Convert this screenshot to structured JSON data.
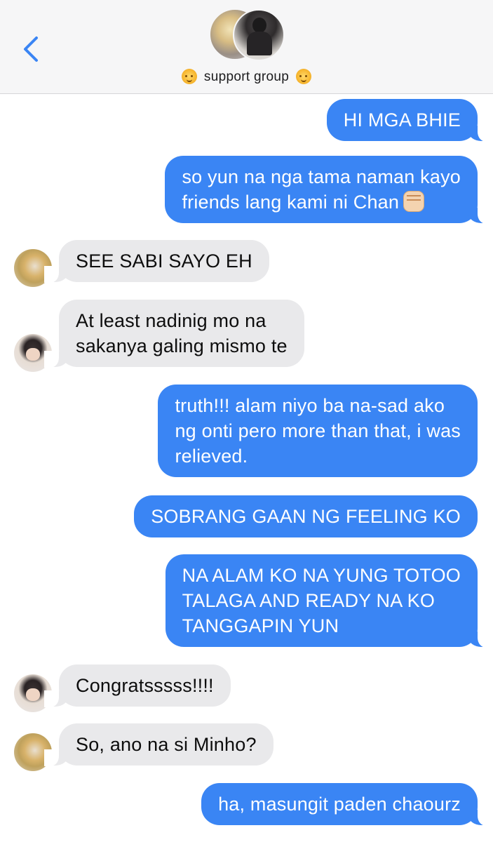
{
  "header": {
    "back_icon": "chevron-left-icon",
    "group_title": "support group",
    "title_emoji": "sun-with-face-icon",
    "accent_color": "#3a85f4"
  },
  "messages": [
    {
      "direction": "out",
      "text": "HI MGA BHIE"
    },
    {
      "direction": "out",
      "text": "so yun na nga tama naman kayo\nfriends lang kami ni Chan",
      "emoji": "raised-fist-icon"
    },
    {
      "direction": "in",
      "text": "SEE SABI SAYO EH",
      "sender_avatar": "avatar-member-1"
    },
    {
      "direction": "in",
      "text": "At least nadinig mo na\nsakanya galing mismo te",
      "sender_avatar": "avatar-member-2"
    },
    {
      "direction": "out",
      "text": "truth!!! alam niyo ba na-sad ako\nng onti pero more than that, i was\nrelieved."
    },
    {
      "direction": "out",
      "text": "SOBRANG GAAN NG FEELING KO"
    },
    {
      "direction": "out",
      "text": "NA ALAM KO NA YUNG TOTOO\nTALAGA AND READY NA KO\nTANGGAPIN YUN"
    },
    {
      "direction": "in",
      "text": "Congratsssss!!!!",
      "sender_avatar": "avatar-member-2"
    },
    {
      "direction": "in",
      "text": "So, ano na si Minho?",
      "sender_avatar": "avatar-member-1"
    },
    {
      "direction": "out",
      "text": "ha, masungit paden chaourz"
    }
  ],
  "colors": {
    "outgoing_bubble": "#3a85f4",
    "incoming_bubble": "#e9e9eb",
    "header_bg": "#f6f6f7"
  }
}
